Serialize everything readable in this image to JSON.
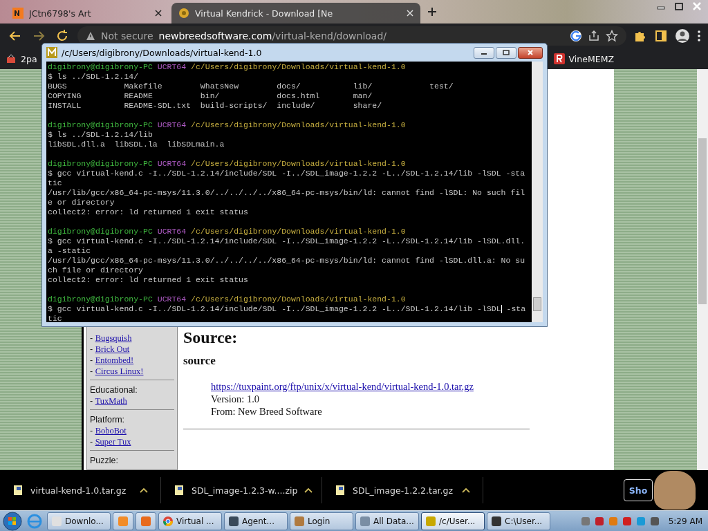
{
  "browser": {
    "tabs": [
      {
        "title": "JCtn6798's Art",
        "selected": false
      },
      {
        "title": "Virtual Kendrick - Download [Ne",
        "selected": true
      }
    ],
    "address": {
      "security": "Not secure",
      "domain": "newbreedsoftware.com",
      "path": "/virtual-kend/download/"
    },
    "bookmarks": [
      {
        "label": "2pa"
      },
      {
        "label": "VineMEMZ"
      }
    ]
  },
  "page": {
    "sidebar": [
      {
        "links": [
          "Bugsquish",
          "Brick Out",
          "Entombed!",
          "Circus Linux!"
        ]
      },
      {
        "heading": "Educational:",
        "links": [
          "TuxMath"
        ]
      },
      {
        "heading": "Platform:",
        "links": [
          "BoboBot",
          "Super Tux"
        ]
      },
      {
        "heading": "Puzzle:"
      }
    ],
    "bullet": "-",
    "title": "Source:",
    "subtitle": "source",
    "link": "https://tuxpaint.org/ftp/unix/x/virtual-kend/virtual-kend-1.0.tar.gz",
    "details": [
      "Version: 1.0",
      "From: New Breed Software"
    ]
  },
  "terminal": {
    "title": "/c/Users/digibrony/Downloads/virtual-kend-1.0",
    "lines": [
      {
        "kind": "prompt",
        "user": "digibrony@digibrony-PC",
        "env": "UCRT64",
        "path": "/c/Users/digibrony/Downloads/virtual-kend-1.0"
      },
      {
        "kind": "output",
        "text": "$ ls ../SDL-1.2.14/"
      },
      {
        "kind": "output",
        "text": "BUGS            Makefile        WhatsNew        docs/           lib/            test/"
      },
      {
        "kind": "output",
        "text": "COPYING         README          bin/            docs.html       man/"
      },
      {
        "kind": "output",
        "text": "INSTALL         README-SDL.txt  build-scripts/  include/        share/"
      },
      {
        "kind": "blank"
      },
      {
        "kind": "prompt",
        "user": "digibrony@digibrony-PC",
        "env": "UCRT64",
        "path": "/c/Users/digibrony/Downloads/virtual-kend-1.0"
      },
      {
        "kind": "output",
        "text": "$ ls ../SDL-1.2.14/lib"
      },
      {
        "kind": "output",
        "text": "libSDL.dll.a  libSDL.la  libSDLmain.a"
      },
      {
        "kind": "blank"
      },
      {
        "kind": "prompt",
        "user": "digibrony@digibrony-PC",
        "env": "UCRT64",
        "path": "/c/Users/digibrony/Downloads/virtual-kend-1.0"
      },
      {
        "kind": "output",
        "text": "$ gcc virtual-kend.c -I../SDL-1.2.14/include/SDL -I../SDL_image-1.2.2 -L../SDL-1.2.14/lib -lSDL -sta"
      },
      {
        "kind": "output",
        "text": "tic"
      },
      {
        "kind": "output",
        "text": "/usr/lib/gcc/x86_64-pc-msys/11.3.0/../../../../x86_64-pc-msys/bin/ld: cannot find -lSDL: No such fil"
      },
      {
        "kind": "output",
        "text": "e or directory"
      },
      {
        "kind": "output",
        "text": "collect2: error: ld returned 1 exit status"
      },
      {
        "kind": "blank"
      },
      {
        "kind": "prompt",
        "user": "digibrony@digibrony-PC",
        "env": "UCRT64",
        "path": "/c/Users/digibrony/Downloads/virtual-kend-1.0"
      },
      {
        "kind": "output",
        "text": "$ gcc virtual-kend.c -I../SDL-1.2.14/include/SDL -I../SDL_image-1.2.2 -L../SDL-1.2.14/lib -lSDL.dll."
      },
      {
        "kind": "output",
        "text": "a -static"
      },
      {
        "kind": "output",
        "text": "/usr/lib/gcc/x86_64-pc-msys/11.3.0/../../../../x86_64-pc-msys/bin/ld: cannot find -lSDL.dll.a: No su"
      },
      {
        "kind": "output",
        "text": "ch file or directory"
      },
      {
        "kind": "output",
        "text": "collect2: error: ld returned 1 exit status"
      },
      {
        "kind": "blank"
      },
      {
        "kind": "prompt",
        "user": "digibrony@digibrony-PC",
        "env": "UCRT64",
        "path": "/c/Users/digibrony/Downloads/virtual-kend-1.0"
      },
      {
        "kind": "input",
        "text": "$ gcc virtual-kend.c -I../SDL-1.2.14/include/SDL -I../SDL_image-1.2.2 -L../SDL-1.2.14/lib -lSDL",
        "after_cursor": " -sta"
      },
      {
        "kind": "output",
        "text": "tic"
      }
    ]
  },
  "downloads": {
    "items": [
      {
        "name": "virtual-kend-1.0.tar.gz"
      },
      {
        "name": "SDL_image-1.2.3-w....zip"
      },
      {
        "name": "SDL_image-1.2.2.tar.gz"
      }
    ],
    "show_all": "Sho"
  },
  "taskbar": {
    "tasks": [
      {
        "kind": "labeled",
        "label": "Downlo...",
        "active": false
      },
      {
        "kind": "icon",
        "active": false
      },
      {
        "kind": "icon",
        "active": false
      },
      {
        "kind": "labeled",
        "label": "Virtual ...",
        "active": false
      },
      {
        "kind": "labeled",
        "label": "Agent...",
        "active": false
      },
      {
        "kind": "labeled",
        "label": "Login",
        "active": false
      },
      {
        "kind": "labeled",
        "label": "All Data...",
        "active": false
      },
      {
        "kind": "labeled",
        "label": "/c/User...",
        "active": true
      },
      {
        "kind": "labeled",
        "label": "C:\\User...",
        "active": false
      }
    ],
    "clock": "5:29 AM"
  }
}
